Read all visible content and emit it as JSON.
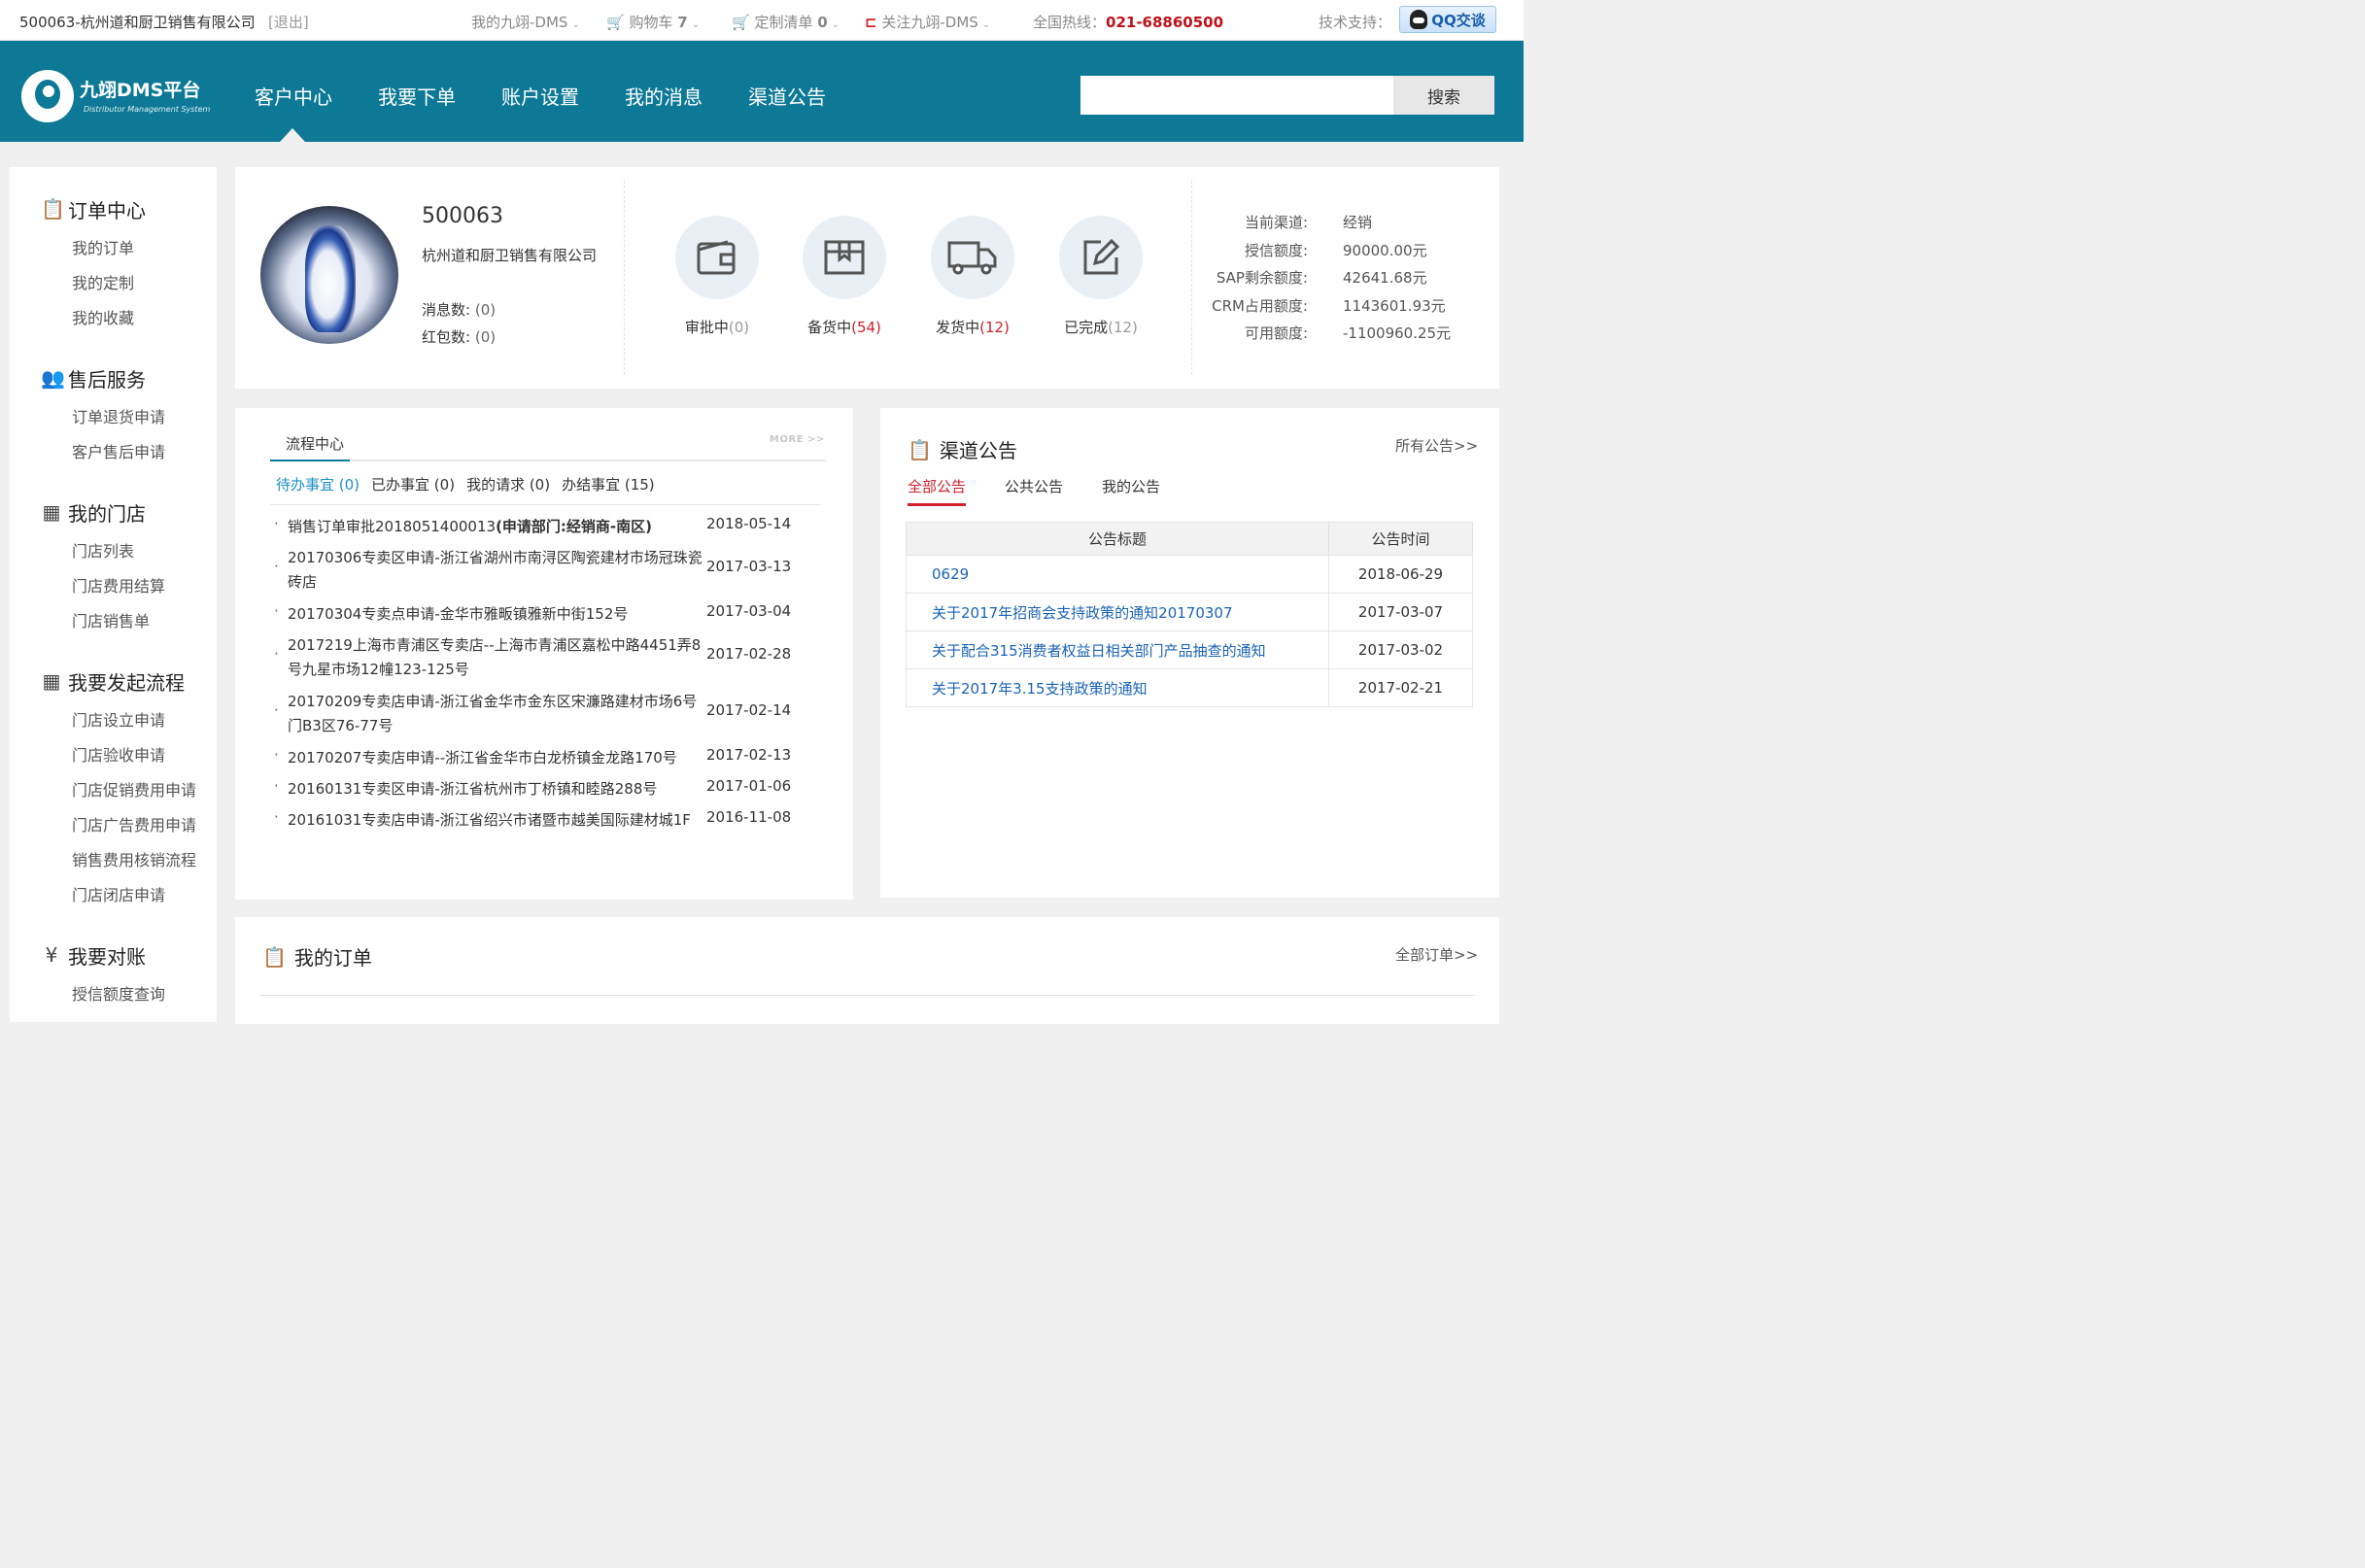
{
  "topbar": {
    "company": "500063-杭州道和厨卫销售有限公司",
    "logout": "[退出]",
    "dms_menu": "我的九翊-DMS",
    "cart_label": "购物车",
    "cart_count": "7",
    "custom_label": "定制清单",
    "custom_count": "0",
    "follow_label": "关注九翊-DMS",
    "hotline_label": "全国热线：",
    "hotline_number": "021-68860500",
    "support_label": "技术支持：",
    "qq_label": "QQ交谈"
  },
  "header": {
    "logo_title": "九翊DMS平台",
    "logo_sub": "Distributor Management System",
    "nav": [
      "客户中心",
      "我要下单",
      "账户设置",
      "我的消息",
      "渠道公告"
    ],
    "search_placeholder": "",
    "search_button": "搜索"
  },
  "sidebar": {
    "groups": [
      {
        "title": "订单中心",
        "icon": "clipboard-icon",
        "items": [
          "我的订单",
          "我的定制",
          "我的收藏"
        ]
      },
      {
        "title": "售后服务",
        "icon": "users-icon",
        "items": [
          "订单退货申请",
          "客户售后申请"
        ]
      },
      {
        "title": "我的门店",
        "icon": "store-icon",
        "items": [
          "门店列表",
          "门店费用结算",
          "门店销售单"
        ]
      },
      {
        "title": "我要发起流程",
        "icon": "store-icon",
        "items": [
          "门店设立申请",
          "门店验收申请",
          "门店促销费用申请",
          "门店广告费用申请",
          "销售费用核销流程",
          "门店闭店申请"
        ]
      },
      {
        "title": "我要对账",
        "icon": "yen-icon",
        "items": [
          "授信额度查询"
        ]
      }
    ]
  },
  "profile": {
    "code": "500063",
    "name": "杭州道和厨卫销售有限公司",
    "msg_label": "消息数:",
    "msg_value": "(0)",
    "red_label": "红包数:",
    "red_value": "(0)",
    "statuses": [
      {
        "label": "审批中",
        "count": "(0)",
        "icon": "wallet-icon"
      },
      {
        "label": "备货中",
        "count": "(54)",
        "icon": "box-icon"
      },
      {
        "label": "发货中",
        "count": "(12)",
        "icon": "truck-icon"
      },
      {
        "label": "已完成",
        "count": "(12)",
        "icon": "edit-icon"
      }
    ],
    "account": [
      {
        "k": "当前渠道:",
        "v": "经销"
      },
      {
        "k": "授信额度:",
        "v": "90000.00元"
      },
      {
        "k": "SAP剩余额度:",
        "v": "42641.68元"
      },
      {
        "k": "CRM占用额度:",
        "v": "1143601.93元"
      },
      {
        "k": "可用额度:",
        "v": "-1100960.25元"
      }
    ]
  },
  "flow": {
    "tab": "流程中心",
    "more": "MORE >>",
    "subtabs": [
      "待办事宜 (0)",
      "已办事宜 (0)",
      "我的请求 (0)",
      "办结事宜 (15)"
    ],
    "rows": [
      {
        "title": "销售订单审批2018051400013",
        "title_bold": "(申请部门:经销商-南区)",
        "date": "2018-05-14"
      },
      {
        "title": "20170306专卖区申请-浙江省湖州市南浔区陶瓷建材市场冠珠瓷砖店",
        "date": "2017-03-13"
      },
      {
        "title": "20170304专卖点申请-金华市雅畈镇雅新中街152号",
        "date": "2017-03-04"
      },
      {
        "title": "2017219上海市青浦区专卖店--上海市青浦区嘉松中路4451弄8号九星市场12幢123-125号",
        "date": "2017-02-28"
      },
      {
        "title": "20170209专卖店申请-浙江省金华市金东区宋濂路建材市场6号门B3区76-77号",
        "date": "2017-02-14"
      },
      {
        "title": "20170207专卖店申请--浙江省金华市白龙桥镇金龙路170号",
        "date": "2017-02-13"
      },
      {
        "title": "20160131专卖区申请-浙江省杭州市丁桥镇和睦路288号",
        "date": "2017-01-06"
      },
      {
        "title": "20161031专卖店申请-浙江省绍兴市诸暨市越美国际建材城1F",
        "date": "2016-11-08"
      }
    ]
  },
  "notice": {
    "title": "渠道公告",
    "all_link": "所有公告>>",
    "tabs": [
      "全部公告",
      "公共公告",
      "我的公告"
    ],
    "col_title": "公告标题",
    "col_date": "公告时间",
    "rows": [
      {
        "title": "0629",
        "date": "2018-06-29"
      },
      {
        "title": "关于2017年招商会支持政策的通知20170307",
        "date": "2017-03-07"
      },
      {
        "title": "关于配合315消费者权益日相关部门产品抽查的通知",
        "date": "2017-03-02"
      },
      {
        "title": "关于2017年3.15支持政策的通知",
        "date": "2017-02-21"
      }
    ]
  },
  "orders": {
    "title": "我的订单",
    "all_link": "全部订单>>"
  },
  "colors": {
    "header_bg": "#0d7996",
    "accent_red": "#d0202b",
    "link_blue": "#1a63b5"
  }
}
